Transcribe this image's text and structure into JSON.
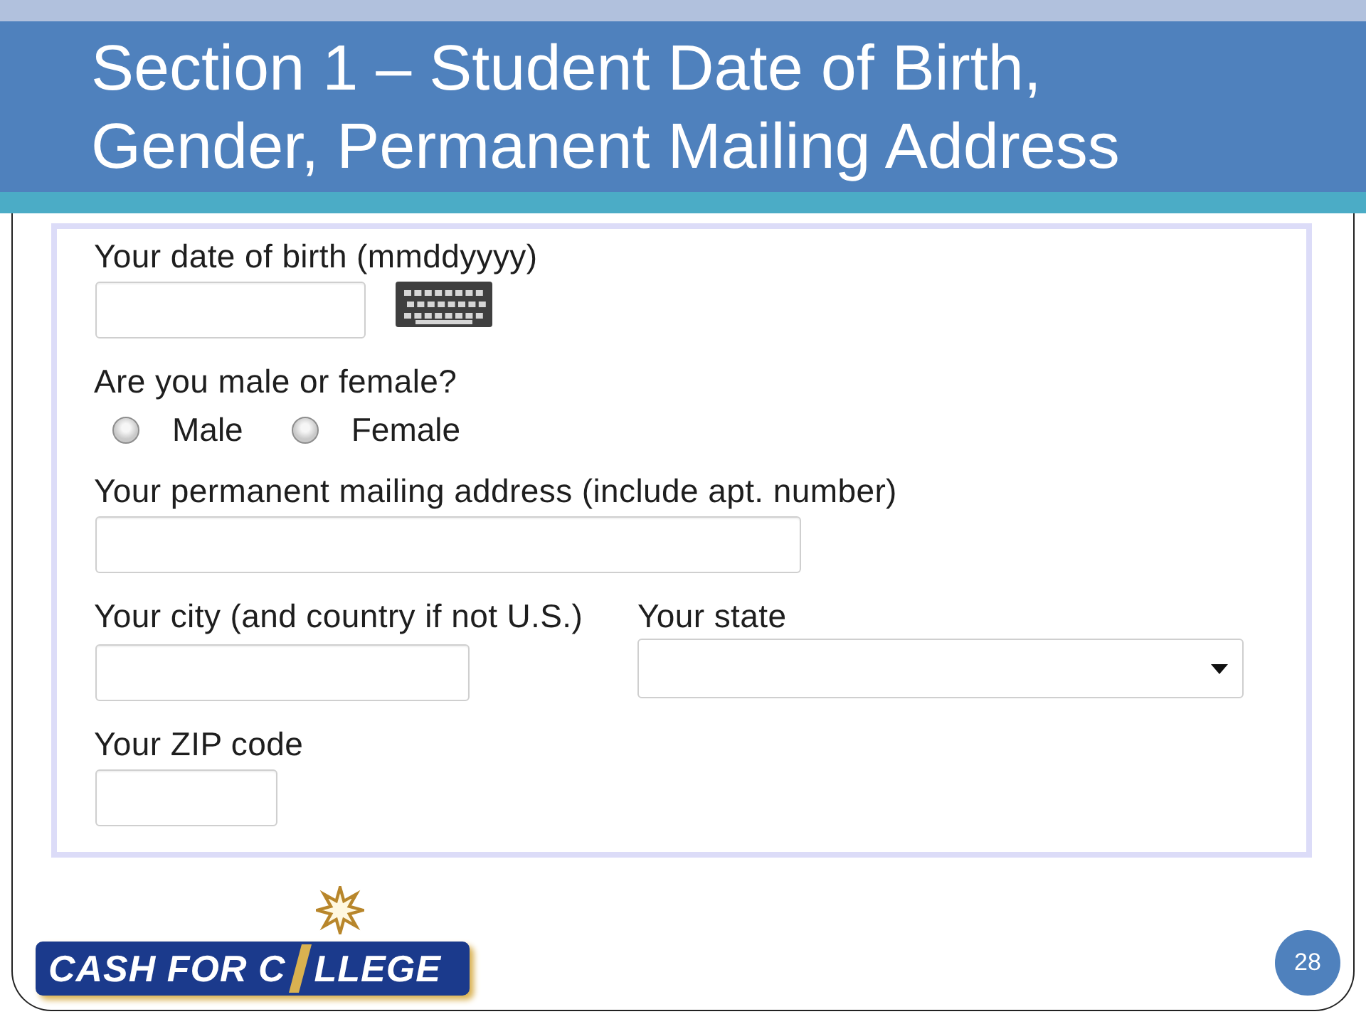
{
  "slide": {
    "title": "Section 1 – Student Date of Birth, Gender, Permanent Mailing Address",
    "page_number": "28"
  },
  "form": {
    "rows": [
      {
        "fields": [
          {
            "kind": "date",
            "label": "Your date of birth (mmddyyyy)"
          }
        ]
      },
      {
        "fields": [
          {
            "kind": "radio",
            "label": "Are you male or female?",
            "options": [
              {
                "label": "Male",
                "selected": false
              },
              {
                "label": "Female",
                "selected": false
              }
            ]
          }
        ]
      },
      {
        "fields": [
          {
            "kind": "address",
            "label": "Your permanent mailing address (include apt. number)"
          }
        ]
      },
      {
        "fields": [
          {
            "kind": "city",
            "label": "Your city (and country if not U.S.)"
          },
          {
            "kind": "select",
            "label": "Your state"
          }
        ]
      },
      {
        "fields": [
          {
            "kind": "zip",
            "label": "Your ZIP code"
          }
        ]
      }
    ]
  },
  "logo": {
    "text_start": "CASH FOR C",
    "text_end": "LLEGE"
  }
}
